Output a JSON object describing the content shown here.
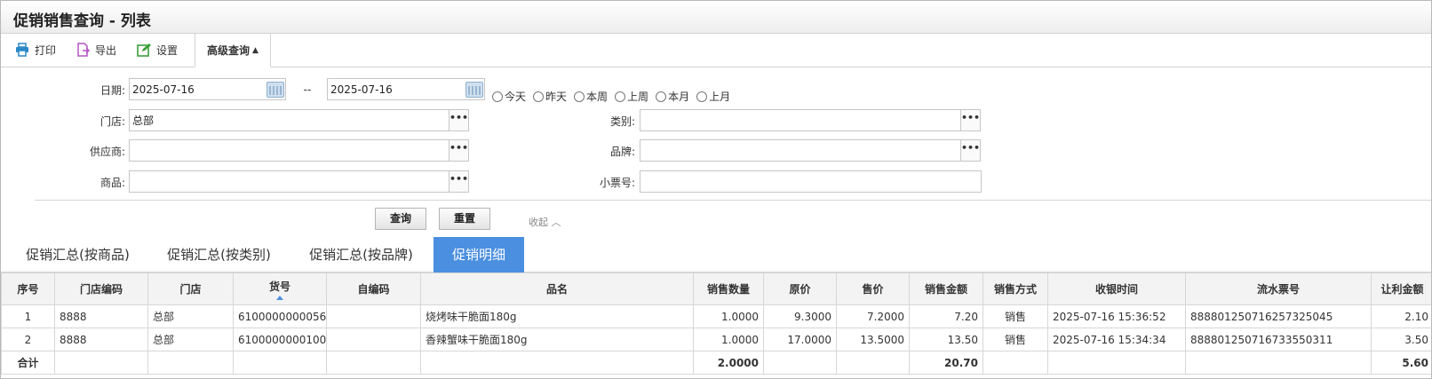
{
  "window": {
    "title": "促销销售查询 - 列表"
  },
  "toolbar": {
    "print_label": "打印",
    "export_label": "导出",
    "settings_label": "设置",
    "advanced_label": "高级查询"
  },
  "form": {
    "date_label": "日期:",
    "date_from": "2025-07-16",
    "date_sep": "--",
    "date_to": "2025-07-16",
    "quick_dates": [
      "今天",
      "昨天",
      "本周",
      "上周",
      "本月",
      "上月"
    ],
    "store_label": "门店:",
    "store_value": "总部",
    "category_label": "类别:",
    "category_value": "",
    "supplier_label": "供应商:",
    "supplier_value": "",
    "brand_label": "品牌:",
    "brand_value": "",
    "product_label": "商品:",
    "product_value": "",
    "receipt_label": "小票号:",
    "receipt_value": "",
    "more_label": "•••",
    "query_label": "查询",
    "reset_label": "重置",
    "collapse_label": "收起 ︿"
  },
  "tabs": [
    {
      "label": "促销汇总(按商品)",
      "active": false
    },
    {
      "label": "促销汇总(按类别)",
      "active": false
    },
    {
      "label": "促销汇总(按品牌)",
      "active": false
    },
    {
      "label": "促销明细",
      "active": true
    }
  ],
  "table": {
    "columns": [
      "序号",
      "门店编码",
      "门店",
      "货号",
      "自编码",
      "品名",
      "销售数量",
      "原价",
      "售价",
      "销售金额",
      "销售方式",
      "收银时间",
      "流水票号",
      "让利金额"
    ],
    "sorted_column": "货号",
    "rows": [
      [
        "1",
        "8888",
        "总部",
        "6100000000056",
        "",
        "烧烤味干脆面180g",
        "1.0000",
        "9.3000",
        "7.2000",
        "7.20",
        "销售",
        "2025-07-16 15:36:52",
        "888801250716257325045",
        "2.10"
      ],
      [
        "2",
        "8888",
        "总部",
        "6100000000100",
        "",
        "香辣蟹味干脆面180g",
        "1.0000",
        "17.0000",
        "13.5000",
        "13.50",
        "销售",
        "2025-07-16 15:34:34",
        "888801250716733550311",
        "3.50"
      ]
    ],
    "total": [
      "合计",
      "",
      "",
      "",
      "",
      "",
      "2.0000",
      "",
      "",
      "20.70",
      "",
      "",
      "",
      "5.60"
    ]
  },
  "colors": {
    "accent": "#4a8fe0",
    "print_icon": "#2b89c8",
    "export_icon": "#b455c4",
    "settings_icon": "#3aa03a"
  }
}
